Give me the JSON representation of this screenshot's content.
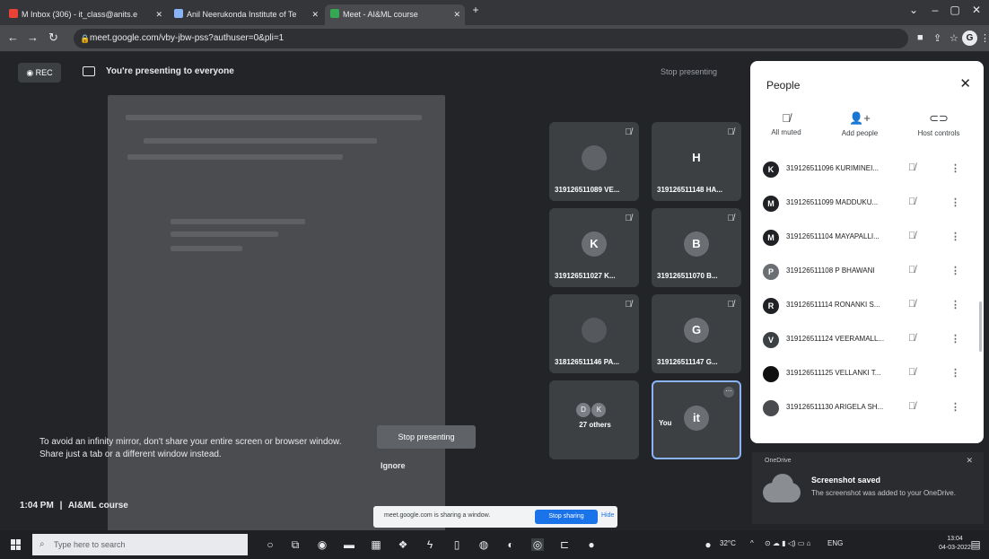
{
  "browser": {
    "tabs": [
      {
        "label": "M Inbox (306) - it_class@anits.e",
        "icon_color": "#ea4335"
      },
      {
        "label": "Anil Neerukonda Institute of Te",
        "icon_color": "#8ab4f8"
      },
      {
        "label": "Meet - AI&ML course",
        "icon_color": "#34a853"
      }
    ],
    "url": "meet.google.com/vby-jbw-pss?authuser=0&pli=1",
    "profile_initial": "G"
  },
  "meet": {
    "rec_label": "REC",
    "presenting_message": "You're presenting to everyone",
    "stop_presenting_top": "Stop presenting",
    "tiles": [
      {
        "name": "319126511089 VE...",
        "avatar": "",
        "color": "#5f6368"
      },
      {
        "name": "319126511148 HA...",
        "avatar": "H",
        "color": "#3c4043"
      },
      {
        "name": "319126511027 K...",
        "avatar": "K",
        "color": "#6b6e73"
      },
      {
        "name": "319126511070 B...",
        "avatar": "B",
        "color": "#6b6e73"
      },
      {
        "name": "318126511146 PA...",
        "avatar": "",
        "color": "#55585d"
      },
      {
        "name": "319126511147 G...",
        "avatar": "G",
        "color": "#6b6e73"
      }
    ],
    "others": {
      "label": "27 others",
      "avatars": [
        "D",
        "K"
      ]
    },
    "you": {
      "label": "You",
      "avatar": "it",
      "more": "⋯"
    },
    "warning": "To avoid an infinity mirror, don't share your entire screen or browser window. Share just a tab or a different window instead.",
    "stop_presenting_button": "Stop presenting",
    "ignore_button": "Ignore",
    "time": "1:04 PM",
    "separator": "|",
    "meeting_name": "AI&ML course",
    "share_bar": {
      "text": "meet.google.com is sharing a window.",
      "stop_label": "Stop sharing",
      "hide_label": "Hide"
    }
  },
  "people_panel": {
    "title": "People",
    "controls": [
      {
        "label": "All muted",
        "icon": "mic-off-icon"
      },
      {
        "label": "Add people",
        "icon": "add-person-icon"
      },
      {
        "label": "Host controls",
        "icon": "toggle-icon"
      }
    ],
    "participants": [
      {
        "initial": "K",
        "name": "319126511096 KURIMINEI...",
        "color": "#202124"
      },
      {
        "initial": "M",
        "name": "319126511099 MADDUKU...",
        "color": "#202124"
      },
      {
        "initial": "M",
        "name": "319126511104 MAYAPALLI...",
        "color": "#202124"
      },
      {
        "initial": "P",
        "name": "319126511108 P BHAWANI",
        "color": "#6b6e73"
      },
      {
        "initial": "R",
        "name": "319126511114 RONANKI S...",
        "color": "#202124"
      },
      {
        "initial": "V",
        "name": "319126511124 VEERAMALL...",
        "color": "#3c4043"
      },
      {
        "initial": "",
        "name": "319126511125 VELLANKI T...",
        "color": "#111111"
      },
      {
        "initial": "",
        "name": "319126511130 ARIGELA SH...",
        "color": "#4a4b4f"
      }
    ]
  },
  "notification": {
    "app": "OneDrive",
    "title": "Screenshot saved",
    "message": "The screenshot was added to your OneDrive."
  },
  "taskbar": {
    "search_placeholder": "Type here to search",
    "temperature": "32°C",
    "language": "ENG",
    "time": "13:04",
    "date": "04-03-2022"
  },
  "colors": {
    "accent": "#1a73e8",
    "meet_bg": "#232428",
    "you_border": "#8ab4f8"
  }
}
